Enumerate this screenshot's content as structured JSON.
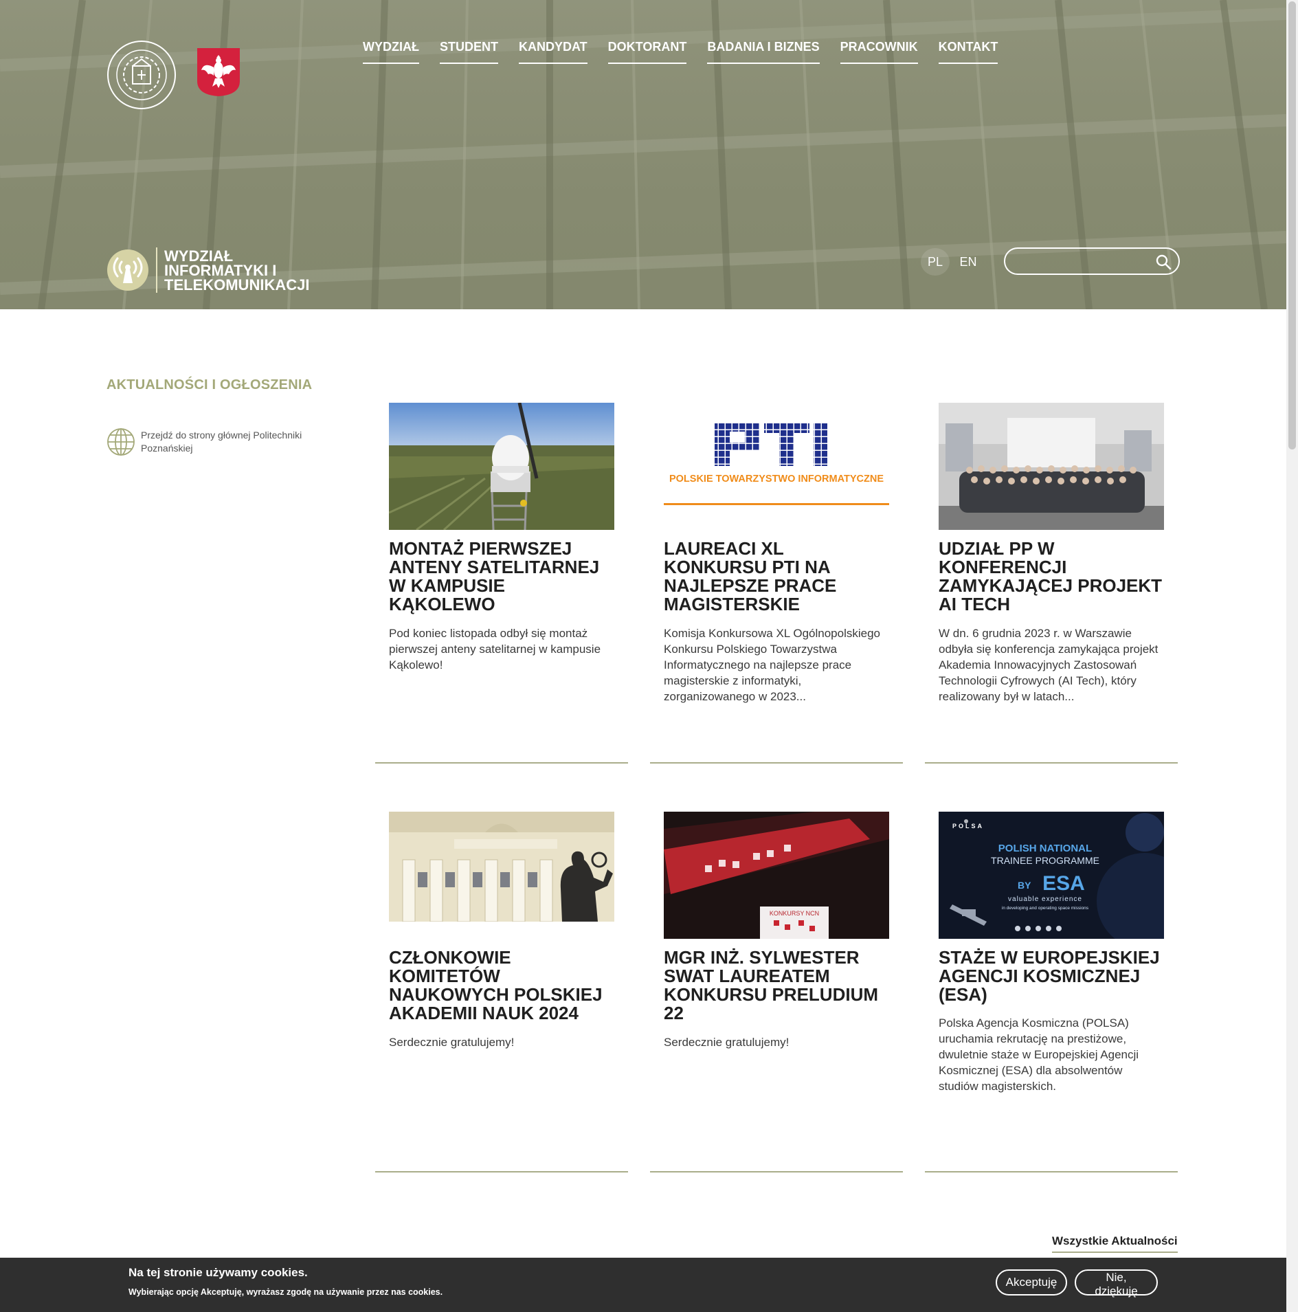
{
  "header": {
    "nav": [
      "WYDZIAŁ",
      "STUDENT",
      "KANDYDAT",
      "DOKTORANT",
      "BADANIA I BIZNES",
      "PRACOWNIK",
      "KONTAKT"
    ],
    "logo_pp_text": "POLITECHNIKA POZNAŃSKA · POZNAN UNIVERSITY OF TECHNOLOGY",
    "faculty_name": "WYDZIAŁ INFORMATYKI I TELEKOMUNIKACJI",
    "languages": [
      "PL",
      "EN"
    ],
    "active_language": "PL",
    "search_placeholder": "",
    "colors": {
      "hero_bg": "#85896f",
      "accent": "#a9ad8a"
    }
  },
  "sidebar": {
    "section_title": "AKTUALNOŚCI I OGŁOSZENIA",
    "main_page_link": "Przejdź do strony głównej Politechniki Poznańskiej"
  },
  "news": [
    {
      "title": "MONTAŻ PIERWSZEJ ANTENY SATELITARNEJ W KAMPUSIE KĄKOLEWO",
      "excerpt": "Pod koniec listopada odbył się montaż pierwszej anteny satelitarnej w kampusie Kąkolewo!"
    },
    {
      "title": "LAUREACI XL KONKURSU PTI NA NAJLEPSZE PRACE MAGISTERSKIE",
      "excerpt": "Komisja Konkursowa XL Ogólnopolskiego Konkursu Polskiego Towarzystwa Informatycznego na najlepsze prace magisterskie z informatyki, zorganizowanego w 2023...",
      "image_text": {
        "logo": "PTI",
        "caption": "POLSKIE TOWARZYSTWO INFORMATYCZNE"
      }
    },
    {
      "title": "UDZIAŁ PP W KONFERENCJI ZAMYKAJĄCEJ PROJEKT AI TECH",
      "excerpt": "W dn. 6 grudnia 2023 r. w Warszawie odbyła się konferencja zamykająca projekt Akademia Innowacyjnych Zastosowań Technologii Cyfrowych (AI Tech), który realizowany był w latach..."
    },
    {
      "title": "CZŁONKOWIE KOMITETÓW NAUKOWYCH POLSKIEJ AKADEMII NAUK 2024",
      "excerpt": "Serdecznie gratulujemy!"
    },
    {
      "title": "MGR INŻ. SYLWESTER SWAT LAUREATEM KONKURSU PRELUDIUM 22",
      "excerpt": "Serdecznie gratulujemy!",
      "image_text": {
        "book": "KONKURSY NCN"
      }
    },
    {
      "title": "STAŻE W EUROPEJSKIEJ AGENCJI KOSMICZNEJ (ESA)",
      "excerpt": "Polska Agencja Kosmiczna (POLSA) uruchamia rekrutację na prestiżowe, dwuletnie staże w Europejskiej Agencji Kosmicznej (ESA) dla absolwentów studiów magisterskich.",
      "image_text": {
        "brand": "POLSA",
        "line1": "POLISH NATIONAL",
        "line2": "TRAINEE PROGRAMME",
        "by": "BY",
        "esa": "ESA",
        "tagline": "valuable experience",
        "subline": "in developing and operating space missions"
      }
    }
  ],
  "all_news_link": "Wszystkie Aktualności",
  "cookies": {
    "title": "Na tej stronie używamy cookies.",
    "text": "Wybierając opcję Akceptuję, wyrażasz zgodę na używanie przez nas cookies.",
    "accept": "Akceptuję",
    "decline": "Nie, dziękuję"
  }
}
